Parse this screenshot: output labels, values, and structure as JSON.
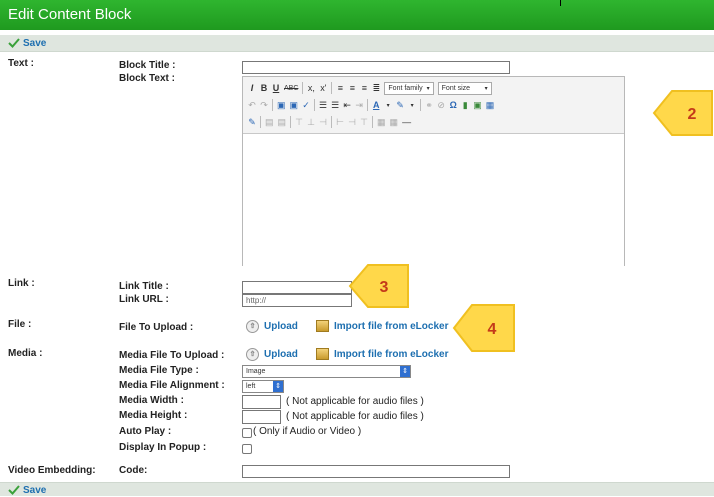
{
  "window": {
    "title": "Edit Content Block"
  },
  "save_label": "Save",
  "text_section": {
    "label": "Text :",
    "block_title_label": "Block Title :",
    "block_text_label": "Block Text :",
    "block_title_value": ""
  },
  "editor": {
    "row1": {
      "bold": "B",
      "italic": "I",
      "underline": "U",
      "strike": "ABC",
      "subscript": "x,",
      "superscript": "x'",
      "font_family": "Font family",
      "font_size": "Font size"
    },
    "row3_dash": "—"
  },
  "link_section": {
    "label": "Link :",
    "title_label": "Link Title :",
    "url_label": "Link URL :",
    "url_value": "http://"
  },
  "file_section": {
    "label": "File :",
    "upload_label": "File To Upload :",
    "upload_button": "Upload",
    "import_button": "Import file from eLocker"
  },
  "media_section": {
    "label": "Media :",
    "upload_label": "Media File To Upload :",
    "upload_button": "Upload",
    "import_button": "Import file from eLocker",
    "type_label": "Media File Type :",
    "type_value": "Image",
    "alignment_label": "Media File Alignment :",
    "alignment_value": "left",
    "width_label": "Media Width :",
    "width_note": "( Not applicable for audio files )",
    "height_label": "Media Height :",
    "height_note": "( Not applicable for audio files )",
    "autoplay_label": "Auto Play :",
    "autoplay_note": "( Only if Audio or Video )",
    "popup_label": "Display In Popup :"
  },
  "video_section": {
    "label": "Video Embedding:",
    "code_label": "Code:"
  },
  "callouts": {
    "c2": "2",
    "c3": "3",
    "c4": "4"
  },
  "colors": {
    "title_green": "#22a322",
    "link_blue": "#1d6fb0",
    "callout_yellow": "#ffd84a",
    "callout_text": "#c43a1a"
  }
}
